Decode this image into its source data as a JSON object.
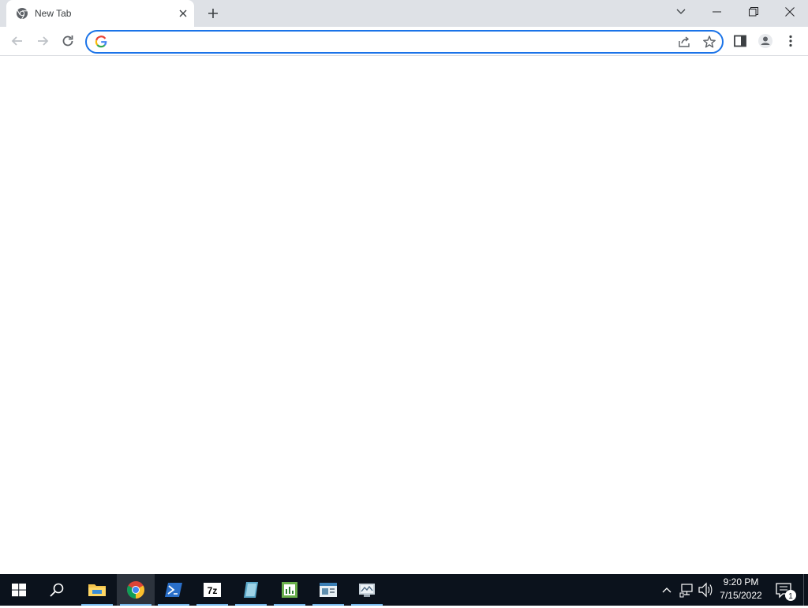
{
  "window": {
    "tab": {
      "title": "New Tab",
      "favicon": "chrome-icon"
    },
    "new_tab_icon": "plus-icon",
    "controls": [
      "tab-search-icon",
      "minimize-icon",
      "restore-icon",
      "close-icon"
    ]
  },
  "toolbar": {
    "back_icon": "arrow-left-icon",
    "forward_icon": "arrow-right-icon",
    "reload_icon": "reload-icon",
    "omnibox": {
      "value": "",
      "placeholder": "",
      "engine_icon": "google-g-icon"
    },
    "share_icon": "share-icon",
    "bookmark_icon": "star-icon",
    "side_panel_icon": "side-panel-icon",
    "profile_icon": "profile-icon",
    "menu_icon": "kebab-menu-icon"
  },
  "taskbar": {
    "items": [
      {
        "name": "start",
        "icon": "windows-logo-icon"
      },
      {
        "name": "search",
        "icon": "search-icon"
      },
      {
        "name": "file-explorer",
        "icon": "folder-icon",
        "running": true
      },
      {
        "name": "chrome",
        "icon": "chrome-icon",
        "running": true,
        "active": true
      },
      {
        "name": "powershell",
        "icon": "powershell-icon",
        "running": true
      },
      {
        "name": "7zip",
        "icon": "7zip-icon",
        "label": "7z",
        "running": true
      },
      {
        "name": "app-5",
        "icon": "blue-book-icon",
        "running": true
      },
      {
        "name": "app-6",
        "icon": "chart-editor-icon",
        "running": true
      },
      {
        "name": "app-7",
        "icon": "window-app-icon",
        "running": true
      },
      {
        "name": "app-8",
        "icon": "monitor-app-icon",
        "running": true
      }
    ],
    "tray": {
      "icons": [
        "chevron-up-icon",
        "network-icon",
        "volume-icon"
      ],
      "time": "9:20 PM",
      "date": "7/15/2022",
      "notification_count": "1"
    }
  },
  "colors": {
    "tabstrip_bg": "#dee1e6",
    "omnibox_focus": "#1a73e8",
    "taskbar_bg": "#0b121c",
    "taskbar_indicator": "#76b9ed"
  }
}
